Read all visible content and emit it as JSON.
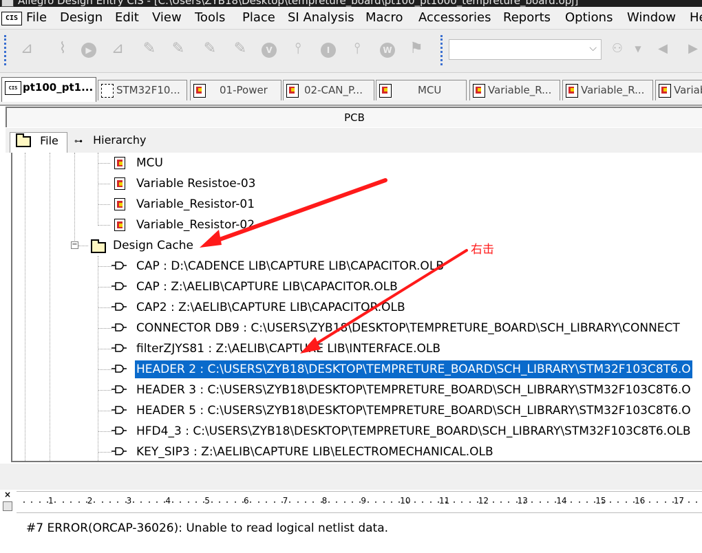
{
  "window": {
    "title": "Allegro Design Entry CIS - [C:\\Users\\ZYB18\\Desktop\\tempreture_board\\pt100_pt1000_tempreture_board.opj]"
  },
  "menu_icon": "CIS",
  "menu": [
    "File",
    "Design",
    "Edit",
    "View",
    "Tools",
    "Place",
    "SI Analysis",
    "Macro",
    "Accessories",
    "Reports",
    "Options",
    "Window",
    "He"
  ],
  "toolbar": {
    "icons": [
      "pcb-netlist-icon",
      "sim-icon",
      "run-icon",
      "probe-icon",
      "marker-icon",
      "marker-add-icon",
      "marker-voltage-icon",
      "marker-current-icon",
      "voltage-icon",
      "voltage-differential-icon",
      "current-icon",
      "current-into-pin-icon",
      "power-icon",
      "power-display-icon"
    ],
    "combo_value": "",
    "find_icon": "binoculars-icon",
    "nav_icons": [
      "prev-icon",
      "next-icon"
    ]
  },
  "doc_tabs": [
    {
      "label": "pt100_pt1...",
      "active": true,
      "icon": "project-icon"
    },
    {
      "label": "STM32F10...",
      "icon": "schematic-folder-icon"
    },
    {
      "label": "01-Power",
      "icon": "schematic-page-icon"
    },
    {
      "label": "02-CAN_P...",
      "icon": "schematic-page-icon"
    },
    {
      "label": "MCU",
      "icon": "schematic-page-icon"
    },
    {
      "label": "Variable_R...",
      "icon": "schematic-page-icon"
    },
    {
      "label": "Variable_R...",
      "icon": "schematic-page-icon"
    },
    {
      "label": "Variab",
      "icon": "schematic-page-icon"
    }
  ],
  "pcb_header": "PCB",
  "panel_tabs": {
    "file": "File",
    "hierarchy": "Hierarchy"
  },
  "tree": {
    "pages": [
      "MCU",
      "Variable Resistoe-03",
      "Variable_Resistor-01",
      "Variable_Resistor-02"
    ],
    "cache_label": "Design Cache",
    "cache_items": [
      "CAP : D:\\CADENCE LIB\\CAPTURE LIB\\CAPACITOR.OLB",
      "CAP : Z:\\AELIB\\CAPTURE LIB\\CAPACITOR.OLB",
      "CAP2 : Z:\\AELIB\\CAPTURE LIB\\CAPACITOR.OLB",
      "CONNECTOR DB9 : C:\\USERS\\ZYB18\\DESKTOP\\TEMPRETURE_BOARD\\SCH_LIBRARY\\CONNECT",
      "filterZJYS81 : Z:\\AELIB\\CAPTURE LIB\\INTERFACE.OLB",
      "HEADER 2 : C:\\USERS\\ZYB18\\DESKTOP\\TEMPRETURE_BOARD\\SCH_LIBRARY\\STM32F103C8T6.O",
      "HEADER 3 : C:\\USERS\\ZYB18\\DESKTOP\\TEMPRETURE_BOARD\\SCH_LIBRARY\\STM32F103C8T6.O",
      "HEADER 5 : C:\\USERS\\ZYB18\\DESKTOP\\TEMPRETURE_BOARD\\SCH_LIBRARY\\STM32F103C8T6.O",
      "HFD4_3 : C:\\USERS\\ZYB18\\DESKTOP\\TEMPRETURE_BOARD\\SCH_LIBRARY\\STM32F103C8T6.OLB",
      "KEY_SIP3 : Z:\\AELIB\\CAPTURE LIB\\ELECTROMECHANICAL.OLB"
    ],
    "selected_index": 5
  },
  "annotation": {
    "label": "右击",
    "color": "#ff1a1a"
  },
  "session_log": {
    "close": "×",
    "ruler": [
      "1",
      "2",
      "3",
      "4",
      "5",
      "6",
      "7",
      "8",
      "9",
      "10",
      "11",
      "12",
      "13",
      "14",
      "15",
      "16",
      "17"
    ],
    "message": "#7 ERROR(ORCAP-36026): Unable to read logical netlist data."
  },
  "colors": {
    "selection": "#0a6acb",
    "annotation": "#ff1a1a",
    "toolbar_grip": "#3a6fd0"
  }
}
